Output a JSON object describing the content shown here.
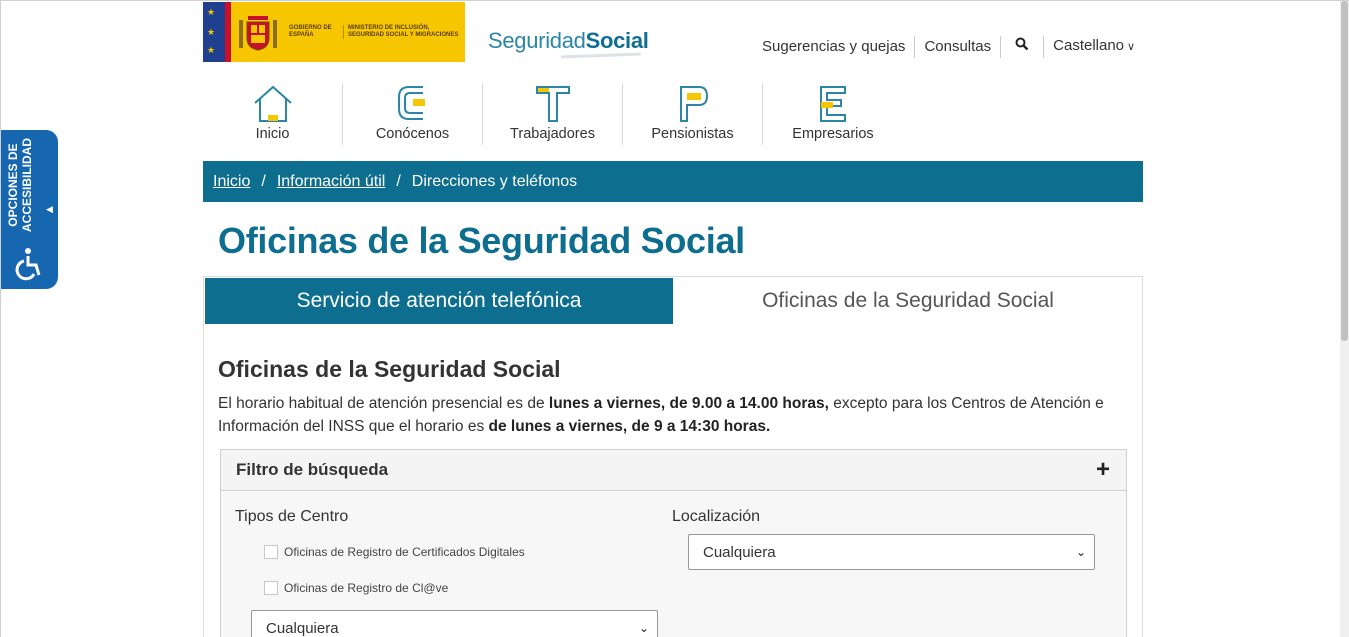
{
  "header": {
    "gov_line1": "Gobierno de España",
    "gov_line2": "Ministerio de Inclusión, Seguridad Social y Migraciones",
    "brand_light": "Seguridad",
    "brand_bold": "Social"
  },
  "topnav": {
    "items": [
      "Sugerencias y quejas",
      "Consultas"
    ],
    "search_icon": "search-icon",
    "language": "Castellano"
  },
  "mainnav": [
    {
      "label": "Inicio",
      "icon": "home-icon"
    },
    {
      "label": "Conócenos",
      "icon": "letter-c-icon"
    },
    {
      "label": "Trabajadores",
      "icon": "letter-t-icon"
    },
    {
      "label": "Pensionistas",
      "icon": "letter-p-icon"
    },
    {
      "label": "Empresarios",
      "icon": "letter-e-icon"
    }
  ],
  "breadcrumb": {
    "items": [
      "Inicio",
      "Información útil",
      "Direcciones y teléfonos"
    ],
    "separator": "/"
  },
  "page": {
    "title": "Oficinas de la Seguridad Social"
  },
  "tabs": [
    {
      "label": "Servicio de atención telefónica",
      "active": true
    },
    {
      "label": "Oficinas de la Seguridad Social",
      "active": false
    }
  ],
  "section": {
    "title": "Oficinas de la Seguridad Social",
    "desc_1": "El horario habitual de atención presencial es de ",
    "desc_b1": "lunes a viernes, de 9.00 a 14.00 horas,",
    "desc_2": " excepto para los Centros de Atención e Información del INSS que el horario es ",
    "desc_b2": "de lunes a viernes, de 9 a 14:30 horas."
  },
  "filter": {
    "title": "Filtro de búsqueda",
    "toggle": "+",
    "tipos_label": "Tipos de Centro",
    "localizacion_label": "Localización",
    "checkboxes": [
      "Oficinas de Registro de Certificados Digitales",
      "Oficinas de Registro de Cl@ve"
    ],
    "tipo_select": "Cualquiera",
    "loc_select": "Cualquiera"
  },
  "accessibility": {
    "label_line1": "OPCIONES DE",
    "label_line2": "ACCESIBILIDAD"
  },
  "colors": {
    "primary": "#0e6e8f",
    "accent": "#f6c700",
    "a11y": "#1666b0"
  }
}
